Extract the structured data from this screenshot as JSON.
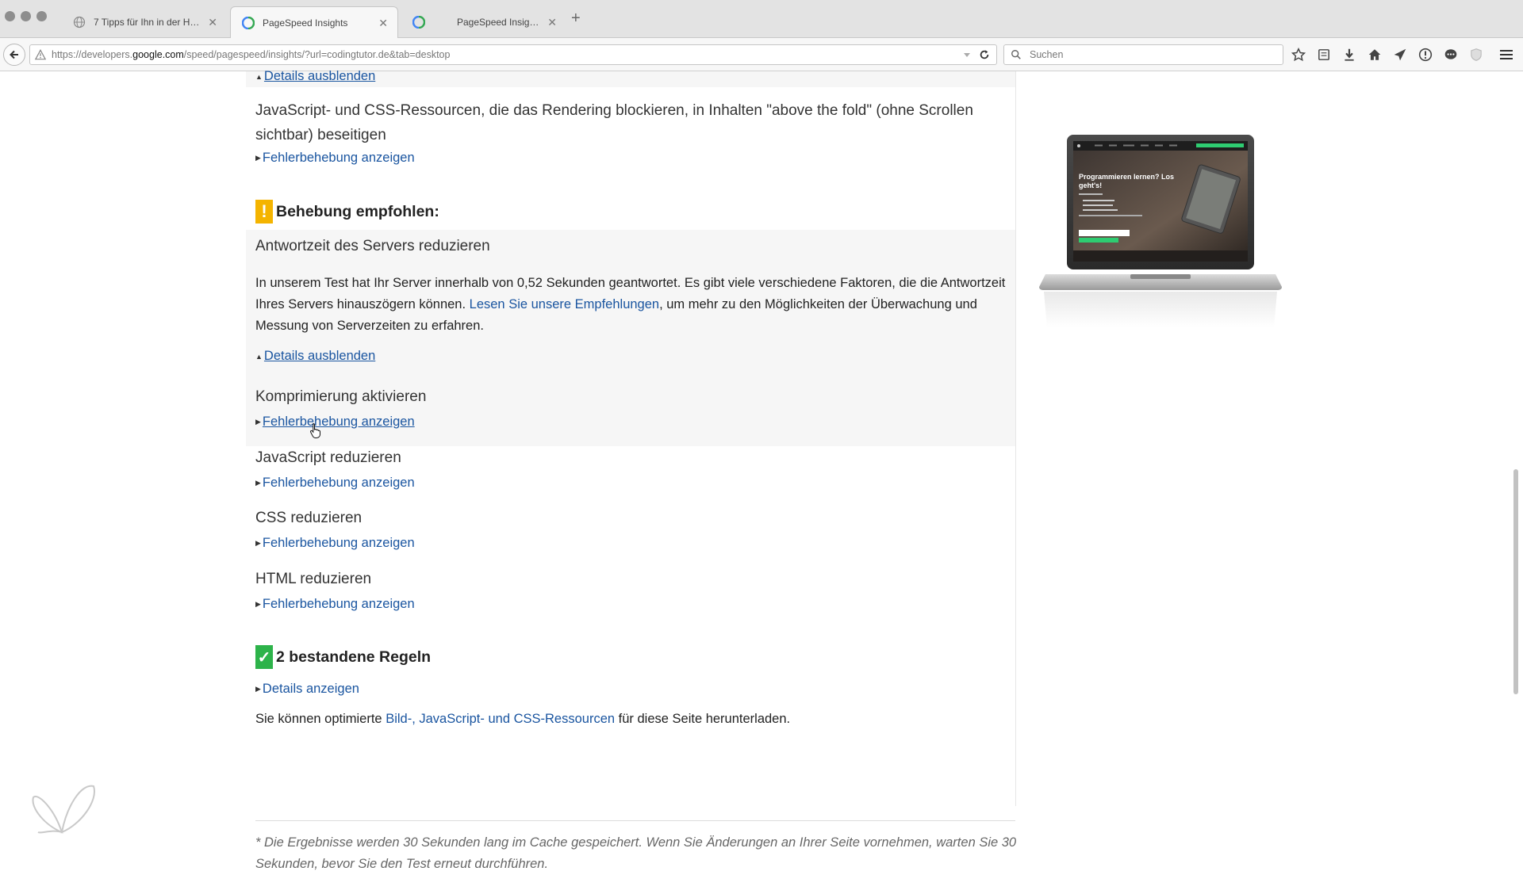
{
  "browser": {
    "tabs": [
      {
        "title": "7 Tipps für Ihn in der Hochz...",
        "active": false
      },
      {
        "title": "PageSpeed Insights",
        "active": true
      },
      {
        "title": "PageSpeed Insights",
        "active": false
      }
    ],
    "url_prefix": "https://developers.",
    "url_domain": "google.com",
    "url_path": "/speed/pagespeed/insights/?url=codingtutor.de&tab=desktop",
    "search_placeholder": "Suchen"
  },
  "page": {
    "top_details_toggle": "Details ausblenden",
    "blocking_rule": {
      "title_line1": "JavaScript- und CSS-Ressourcen, die das Rendering blockieren, in Inhalten \"above the fold\" (ohne Scrollen",
      "title_line2": "sichtbar) beseitigen",
      "link": "Fehlerbehebung anzeigen"
    },
    "recommended": {
      "badge": "!",
      "heading": "Behebung empfohlen:",
      "badge_color": "#f4b400",
      "server_rule": {
        "title": "Antwortzeit des Servers reduzieren",
        "text_before": "In unserem Test hat Ihr Server innerhalb von 0,52 Sekunden geantwortet. Es gibt viele verschiedene Faktoren, die die Antwortzeit Ihres Servers hinauszögern können. ",
        "link_text": "Lesen Sie unsere Empfehlungen",
        "text_after": ", um mehr zu den Möglichkeiten der Überwachung und Messung von Serverzeiten zu erfahren.",
        "details_toggle": "Details ausblenden"
      },
      "rules": [
        {
          "title": "Komprimierung aktivieren",
          "link": "Fehlerbehebung anzeigen"
        },
        {
          "title": "JavaScript reduzieren",
          "link": "Fehlerbehebung anzeigen"
        },
        {
          "title": "CSS reduzieren",
          "link": "Fehlerbehebung anzeigen"
        },
        {
          "title": "HTML reduzieren",
          "link": "Fehlerbehebung anzeigen"
        }
      ]
    },
    "passed": {
      "badge": "✓",
      "heading": "2 bestandene Regeln",
      "badge_color": "#2db34a",
      "details_link": "Details anzeigen"
    },
    "download": {
      "text_before": "Sie können optimierte ",
      "link_text": "Bild-, JavaScript- und CSS-Ressourcen",
      "text_after": " für diese Seite herunterladen."
    },
    "footnote": "* Die Ergebnisse werden 30 Sekunden lang im Cache gespeichert. Wenn Sie Änderungen an Ihrer Seite vornehmen, warten Sie 30 Sekunden, bevor Sie den Test erneut durchführen."
  },
  "preview": {
    "headline": "Programmieren lernen? Los geht's!",
    "accent_color": "#2ecc71"
  },
  "colors": {
    "link": "#1a55a0"
  }
}
